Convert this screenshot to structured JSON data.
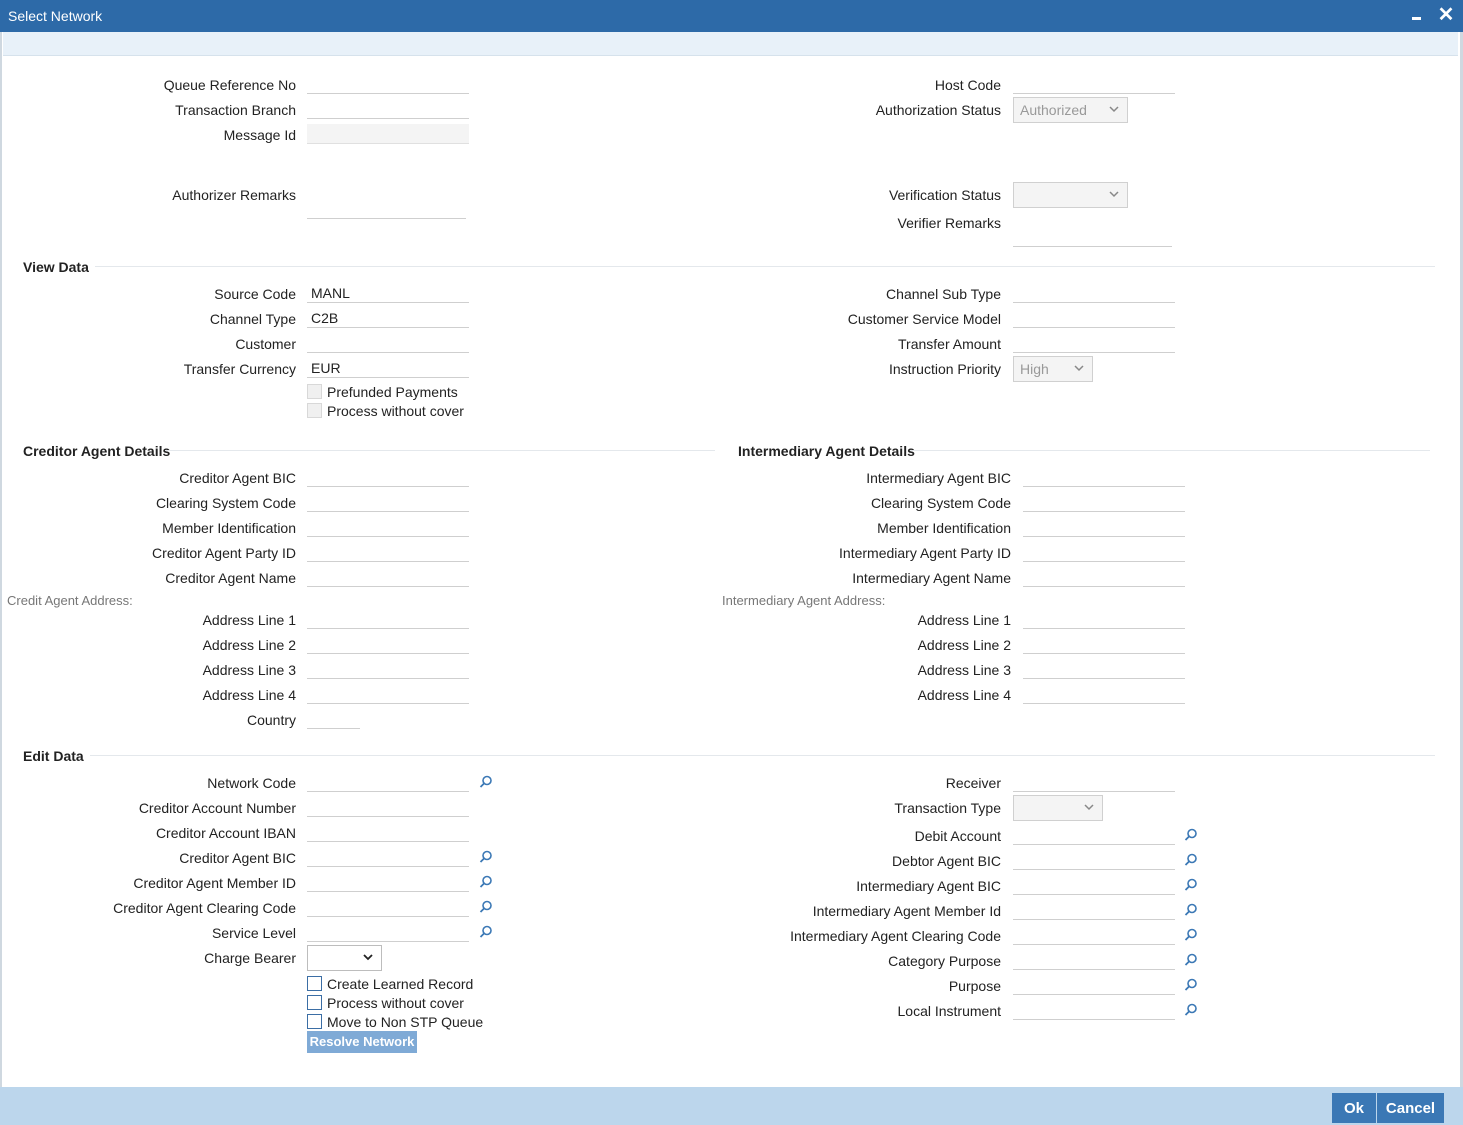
{
  "window": {
    "title": "Select Network"
  },
  "header": {
    "queue_reference_no": {
      "label": "Queue Reference No",
      "value": ""
    },
    "transaction_branch": {
      "label": "Transaction Branch",
      "value": ""
    },
    "message_id": {
      "label": "Message Id",
      "value": ""
    },
    "authorizer_remarks": {
      "label": "Authorizer Remarks",
      "value": ""
    },
    "host_code": {
      "label": "Host Code",
      "value": ""
    },
    "authorization_status": {
      "label": "Authorization Status",
      "value": "Authorized"
    },
    "verification_status": {
      "label": "Verification Status",
      "value": ""
    },
    "verifier_remarks": {
      "label": "Verifier Remarks",
      "value": ""
    }
  },
  "view_data": {
    "title": "View Data",
    "source_code": {
      "label": "Source Code",
      "value": "MANL"
    },
    "channel_type": {
      "label": "Channel Type",
      "value": "C2B"
    },
    "customer": {
      "label": "Customer",
      "value": ""
    },
    "transfer_currency": {
      "label": "Transfer Currency",
      "value": "EUR"
    },
    "prefunded_payments": {
      "label": "Prefunded Payments"
    },
    "process_without_cover": {
      "label": "Process without cover"
    },
    "channel_sub_type": {
      "label": "Channel Sub Type",
      "value": ""
    },
    "customer_service_model": {
      "label": "Customer Service Model",
      "value": ""
    },
    "transfer_amount": {
      "label": "Transfer Amount",
      "value": ""
    },
    "instruction_priority": {
      "label": "Instruction Priority",
      "value": "High"
    }
  },
  "creditor_agent": {
    "title": "Creditor Agent Details",
    "bic": {
      "label": "Creditor Agent BIC",
      "value": ""
    },
    "clearing_system_code": {
      "label": "Clearing System Code",
      "value": ""
    },
    "member_identification": {
      "label": "Member Identification",
      "value": ""
    },
    "party_id": {
      "label": "Creditor Agent Party ID",
      "value": ""
    },
    "name": {
      "label": "Creditor Agent Name",
      "value": ""
    },
    "address_title": "Credit Agent Address:",
    "address_line_1": {
      "label": "Address Line 1",
      "value": ""
    },
    "address_line_2": {
      "label": "Address Line 2",
      "value": ""
    },
    "address_line_3": {
      "label": "Address Line 3",
      "value": ""
    },
    "address_line_4": {
      "label": "Address Line 4",
      "value": ""
    },
    "country": {
      "label": "Country",
      "value": ""
    }
  },
  "intermediary_agent": {
    "title": "Intermediary Agent Details",
    "bic": {
      "label": "Intermediary Agent BIC",
      "value": ""
    },
    "clearing_system_code": {
      "label": "Clearing System Code",
      "value": ""
    },
    "member_identification": {
      "label": "Member Identification",
      "value": ""
    },
    "party_id": {
      "label": "Intermediary Agent Party ID",
      "value": ""
    },
    "name": {
      "label": "Intermediary Agent Name",
      "value": ""
    },
    "address_title": "Intermediary Agent Address:",
    "address_line_1": {
      "label": "Address Line 1",
      "value": ""
    },
    "address_line_2": {
      "label": "Address Line 2",
      "value": ""
    },
    "address_line_3": {
      "label": "Address Line 3",
      "value": ""
    },
    "address_line_4": {
      "label": "Address Line 4",
      "value": ""
    }
  },
  "edit_data": {
    "title": "Edit Data",
    "network_code": {
      "label": "Network Code",
      "value": ""
    },
    "creditor_account_number": {
      "label": "Creditor Account Number",
      "value": ""
    },
    "creditor_account_iban": {
      "label": "Creditor Account IBAN",
      "value": ""
    },
    "creditor_agent_bic": {
      "label": "Creditor Agent BIC",
      "value": ""
    },
    "creditor_agent_member_id": {
      "label": "Creditor Agent Member ID",
      "value": ""
    },
    "creditor_agent_clearing_code": {
      "label": "Creditor Agent Clearing Code",
      "value": ""
    },
    "service_level": {
      "label": "Service Level",
      "value": ""
    },
    "charge_bearer": {
      "label": "Charge Bearer",
      "value": ""
    },
    "create_learned_record": {
      "label": "Create Learned Record"
    },
    "process_without_cover": {
      "label": "Process without cover"
    },
    "move_to_non_stp_queue": {
      "label": "Move to Non STP Queue"
    },
    "resolve_network_label": "Resolve Network",
    "receiver": {
      "label": "Receiver",
      "value": ""
    },
    "transaction_type": {
      "label": "Transaction Type",
      "value": ""
    },
    "debit_account": {
      "label": "Debit Account",
      "value": ""
    },
    "debtor_agent_bic": {
      "label": "Debtor Agent BIC",
      "value": ""
    },
    "intermediary_agent_bic": {
      "label": "Intermediary Agent BIC",
      "value": ""
    },
    "intermediary_agent_member_id": {
      "label": "Intermediary Agent Member Id",
      "value": ""
    },
    "intermediary_agent_clearing_code": {
      "label": "Intermediary Agent Clearing Code",
      "value": ""
    },
    "category_purpose": {
      "label": "Category Purpose",
      "value": ""
    },
    "purpose": {
      "label": "Purpose",
      "value": ""
    },
    "local_instrument": {
      "label": "Local Instrument",
      "value": ""
    }
  },
  "footer": {
    "ok_label": "Ok",
    "cancel_label": "Cancel"
  },
  "colors": {
    "title_bar": "#2d6aa8",
    "button": "#3b78b5",
    "footer": "#bcd6ec",
    "resolve_button": "#7faad6"
  },
  "icons": {
    "lookup": "search-icon",
    "dropdown": "chevron-down-icon",
    "close": "close-icon",
    "minimize": "minimize-icon"
  }
}
